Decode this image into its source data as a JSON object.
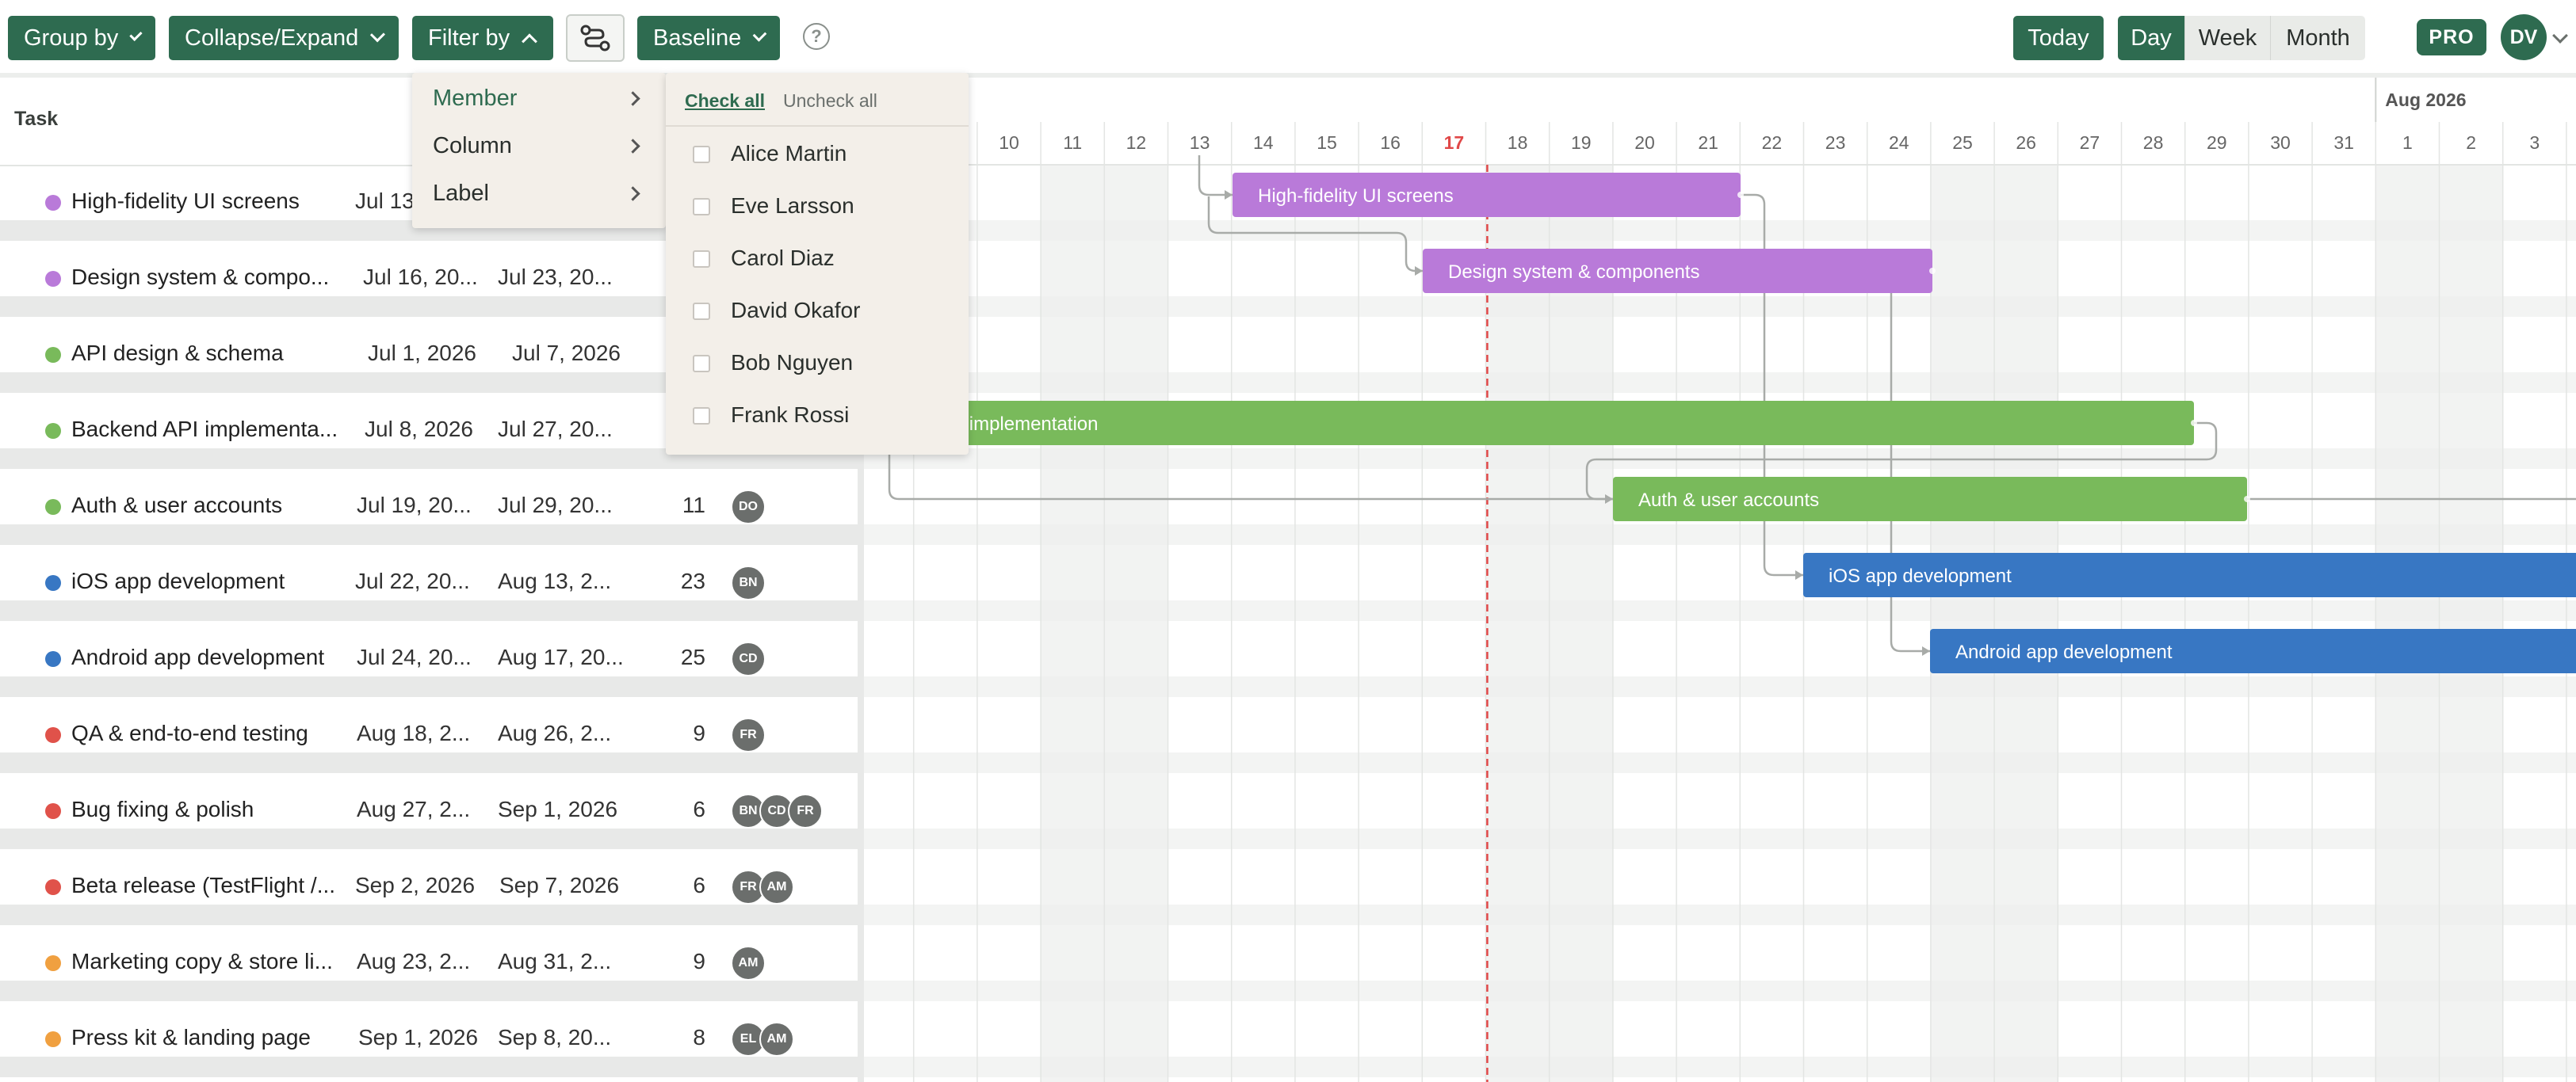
{
  "toolbar": {
    "group_by": "Group by",
    "collapse_expand": "Collapse/Expand",
    "filter_by": "Filter by",
    "baseline": "Baseline",
    "help": "?",
    "today": "Today",
    "views": [
      "Day",
      "Week",
      "Month"
    ],
    "active_view": "Day",
    "plan_badge": "PRO",
    "user_initials": "DV"
  },
  "table": {
    "task_header": "Task",
    "rows": [
      {
        "name": "High-fidelity UI screens",
        "start": "Jul 13",
        "end": "",
        "duration": "",
        "color": "#b97ad9",
        "assignees": []
      },
      {
        "name": "Design system & compo...",
        "start": "Jul 16, 20...",
        "end": "Jul 23, 20...",
        "duration": "",
        "color": "#b97ad9",
        "assignees": []
      },
      {
        "name": "API design & schema",
        "start": "Jul 1, 2026",
        "end": "Jul 7, 2026",
        "duration": "",
        "color": "#79ba5b",
        "assignees": []
      },
      {
        "name": "Backend API implementa...",
        "start": "Jul 8, 2026",
        "end": "Jul 27, 20...",
        "duration": "",
        "color": "#79ba5b",
        "assignees": []
      },
      {
        "name": "Auth & user accounts",
        "start": "Jul 19, 20...",
        "end": "Jul 29, 20...",
        "duration": "11",
        "color": "#79ba5b",
        "assignees": [
          "DO"
        ]
      },
      {
        "name": "iOS app development",
        "start": "Jul 22, 20...",
        "end": "Aug 13, 2...",
        "duration": "23",
        "color": "#3877c3",
        "assignees": [
          "BN"
        ]
      },
      {
        "name": "Android app development",
        "start": "Jul 24, 20...",
        "end": "Aug 17, 20...",
        "duration": "25",
        "color": "#3877c3",
        "assignees": [
          "CD"
        ]
      },
      {
        "name": "QA & end-to-end testing",
        "start": "Aug 18, 2...",
        "end": "Aug 26, 2...",
        "duration": "9",
        "color": "#e0524a",
        "assignees": [
          "FR"
        ]
      },
      {
        "name": "Bug fixing & polish",
        "start": "Aug 27, 2...",
        "end": "Sep 1, 2026",
        "duration": "6",
        "color": "#e0524a",
        "assignees": [
          "BN",
          "CD",
          "FR"
        ]
      },
      {
        "name": "Beta release (TestFlight /...",
        "start": "Sep 2, 2026",
        "end": "Sep 7, 2026",
        "duration": "6",
        "color": "#e0524a",
        "assignees": [
          "FR",
          "AM"
        ]
      },
      {
        "name": "Marketing copy & store li...",
        "start": "Aug 23, 2...",
        "end": "Aug 31, 2...",
        "duration": "9",
        "color": "#f0a040",
        "assignees": [
          "AM"
        ]
      },
      {
        "name": "Press kit & landing page",
        "start": "Sep 1, 2026",
        "end": "Sep 8, 20...",
        "duration": "8",
        "color": "#f0a040",
        "assignees": [
          "EL",
          "AM"
        ]
      }
    ]
  },
  "timeline": {
    "month_label": "Aug 2026",
    "days": [
      "10",
      "11",
      "12",
      "13",
      "14",
      "15",
      "16",
      "17",
      "18",
      "19",
      "20",
      "21",
      "22",
      "23",
      "24",
      "25",
      "26",
      "27",
      "28",
      "29",
      "30",
      "31",
      "1",
      "2",
      "3"
    ],
    "today_day": "17",
    "today_color": "#e04848",
    "bars": [
      {
        "label": "High-fidelity UI screens",
        "row": 0,
        "color": "#b97ad9"
      },
      {
        "label": "Design system & components",
        "row": 1,
        "color": "#b97ad9"
      },
      {
        "label": "ckend API implementation",
        "row": 3,
        "color": "#79ba5b"
      },
      {
        "label": "Auth & user accounts",
        "row": 4,
        "color": "#79ba5b"
      },
      {
        "label": "iOS app development",
        "row": 5,
        "color": "#3877c3"
      },
      {
        "label": "Android app development",
        "row": 6,
        "color": "#3877c3"
      }
    ]
  },
  "filter_menu": {
    "items": [
      "Member",
      "Column",
      "Label"
    ],
    "highlighted": "Member"
  },
  "member_menu": {
    "check_all": "Check all",
    "uncheck_all": "Uncheck all",
    "members": [
      "Alice Martin",
      "Eve Larsson",
      "Carol Diaz",
      "David Okafor",
      "Bob Nguyen",
      "Frank Rossi"
    ]
  }
}
